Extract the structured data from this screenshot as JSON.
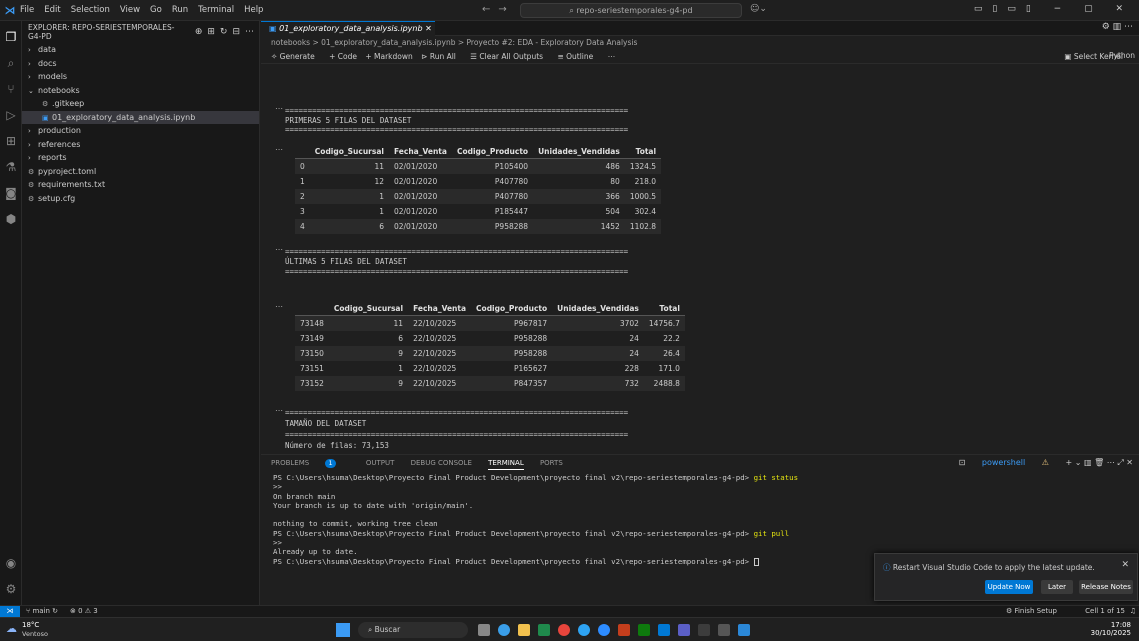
{
  "titlebar": {
    "menu": [
      "File",
      "Edit",
      "Selection",
      "View",
      "Go",
      "Run",
      "Terminal",
      "Help"
    ],
    "search": "repo-seriestemporales-g4-pd"
  },
  "sidebar": {
    "header": "EXPLORER: REPO-SERIESTEMPORALES-G4-PD",
    "items": [
      {
        "label": "data",
        "type": "folder"
      },
      {
        "label": "docs",
        "type": "folder"
      },
      {
        "label": "models",
        "type": "folder"
      },
      {
        "label": "notebooks",
        "type": "folder-open"
      },
      {
        "label": ".gitkeep",
        "type": "file"
      },
      {
        "label": "01_exploratory_data_analysis.ipynb",
        "type": "notebook"
      },
      {
        "label": "production",
        "type": "folder"
      },
      {
        "label": "references",
        "type": "folder"
      },
      {
        "label": "reports",
        "type": "folder"
      },
      {
        "label": "pyproject.toml",
        "type": "file"
      },
      {
        "label": "requirements.txt",
        "type": "file"
      },
      {
        "label": "setup.cfg",
        "type": "file"
      }
    ]
  },
  "editor": {
    "tab_label": "01_exploratory_data_analysis.ipynb",
    "breadcrumb": "notebooks > 01_exploratory_data_analysis.ipynb > Proyecto #2: EDA - Exploratory Data Analysis",
    "toolbar": {
      "generate": "Generate",
      "code": "+ Code",
      "markdown": "+ Markdown",
      "run_all": "Run All",
      "clear": "Clear All Outputs",
      "outline": "Outline",
      "select_kernel": "Select Kernel",
      "lang": "Python"
    },
    "rule": "============================================================================",
    "section1": "PRIMERAS 5 FILAS DEL DATASET",
    "section2": "ÚLTIMAS 5 FILAS DEL DATASET",
    "section3": "TAMAÑO DEL DATASET",
    "rows_line": "Número de filas: 73,153",
    "columns": [
      "",
      "Codigo_Sucursal",
      "Fecha_Venta",
      "Codigo_Producto",
      "Unidades_Vendidas",
      "Total"
    ],
    "table1": [
      [
        "0",
        "11",
        "02/01/2020",
        "P105400",
        "486",
        "1324.5"
      ],
      [
        "1",
        "12",
        "02/01/2020",
        "P407780",
        "80",
        "218.0"
      ],
      [
        "2",
        "1",
        "02/01/2020",
        "P407780",
        "366",
        "1000.5"
      ],
      [
        "3",
        "1",
        "02/01/2020",
        "P185447",
        "504",
        "302.4"
      ],
      [
        "4",
        "6",
        "02/01/2020",
        "P958288",
        "1452",
        "1102.8"
      ]
    ],
    "table2": [
      [
        "73148",
        "11",
        "22/10/2025",
        "P967817",
        "3702",
        "14756.7"
      ],
      [
        "73149",
        "6",
        "22/10/2025",
        "P958288",
        "24",
        "22.2"
      ],
      [
        "73150",
        "9",
        "22/10/2025",
        "P958288",
        "24",
        "26.4"
      ],
      [
        "73151",
        "1",
        "22/10/2025",
        "P165627",
        "228",
        "171.0"
      ],
      [
        "73152",
        "9",
        "22/10/2025",
        "P847357",
        "732",
        "2488.8"
      ]
    ]
  },
  "panel": {
    "tabs": [
      "PROBLEMS",
      "OUTPUT",
      "DEBUG CONSOLE",
      "TERMINAL",
      "PORTS"
    ],
    "problems_count": "1",
    "shell": "powershell",
    "terminal": [
      {
        "t": "PS C:\\Users\\hsuma\\Desktop\\Proyecto Final Product Development\\proyecto final v2\\repo-seriestemporales-g4-pd> ",
        "c": "git status"
      },
      {
        "t": ">>",
        "c": ""
      },
      {
        "t": "On branch main",
        "c": ""
      },
      {
        "t": "Your branch is up to date with 'origin/main'.",
        "c": ""
      },
      {
        "t": "",
        "c": ""
      },
      {
        "t": "nothing to commit, working tree clean",
        "c": ""
      },
      {
        "t": "PS C:\\Users\\hsuma\\Desktop\\Proyecto Final Product Development\\proyecto final v2\\repo-seriestemporales-g4-pd> ",
        "c": "git pull"
      },
      {
        "t": ">>",
        "c": ""
      },
      {
        "t": "Already up to date.",
        "c": ""
      },
      {
        "t": "PS C:\\Users\\hsuma\\Desktop\\Proyecto Final Product Development\\proyecto final v2\\repo-seriestemporales-g4-pd> ",
        "c": ""
      }
    ]
  },
  "toast": {
    "message": "Restart Visual Studio Code to apply the latest update.",
    "update_now": "Update Now",
    "later": "Later",
    "release_notes": "Release Notes"
  },
  "statusbar": {
    "branch": "main",
    "errors": "0",
    "warnings": "3",
    "finish_setup": "Finish Setup",
    "cell": "Cell 1 of 15"
  },
  "taskbar": {
    "temp": "18°C",
    "weather": "Ventoso",
    "search": "Buscar",
    "time": "17:08",
    "date": "30/10/2025"
  },
  "colors": {
    "accent": "#0078d4",
    "bg": "#1f1f1f",
    "sidebar": "#181818"
  }
}
